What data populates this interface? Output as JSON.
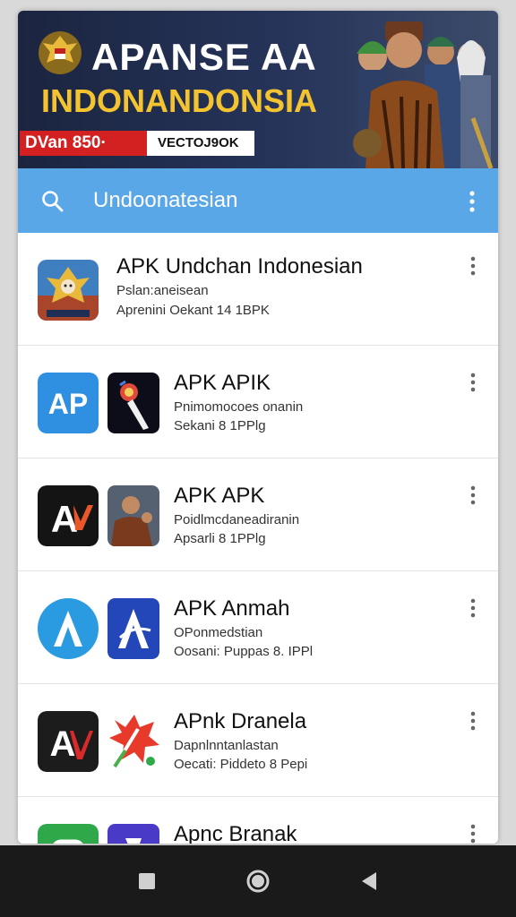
{
  "banner": {
    "title_line1": "APANSE AA",
    "title_line2": "INDONANDONSIA",
    "promo": "DVan 850·",
    "tag": "VECTOJ9OK"
  },
  "search": {
    "value": "Undoonatesian"
  },
  "apps": [
    {
      "name": "APK Undchan Indonesian",
      "sub1": "Pslan:aneisean",
      "sub2": "Aprenini Oekant 14 1BPK"
    },
    {
      "name": "APK APIK",
      "sub1": "Pnimomocoes onanin",
      "sub2": "Sekani 8 1PPlg"
    },
    {
      "name": "APK APK",
      "sub1": "Poidlmcdaneadiranin",
      "sub2": "Apsarli 8 1PPlg"
    },
    {
      "name": "APK Anmah",
      "sub1": "OPonmedstian",
      "sub2": "Oosani: Puppas 8. IPPl"
    },
    {
      "name": "APnk Dranela",
      "sub1": "Dapnlnntanlastan",
      "sub2": "Oecati: Piddeto 8 Pepi"
    },
    {
      "name": "Apnc Branak",
      "sub1": "",
      "sub2": ""
    }
  ],
  "icons": {
    "search": "search-icon",
    "menu": "more-vert-icon",
    "nav_recent": "square-icon",
    "nav_home": "circle-icon",
    "nav_back": "triangle-back-icon"
  },
  "colors": {
    "header_blue": "#5aa7e8",
    "banner_navy": "#1b2540",
    "promo_red": "#d32020",
    "title_gold": "#f4c430"
  }
}
